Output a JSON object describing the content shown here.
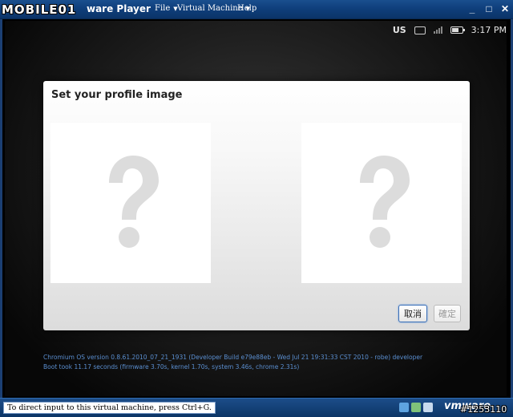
{
  "titlebar": {
    "logo_text": "MOBILE01",
    "app_title": "ware Player",
    "menus": [
      "File",
      "Virtual Machine",
      "Help"
    ]
  },
  "statusbar": {
    "keyboard_layout": "US",
    "time": "3:17 PM"
  },
  "dialog": {
    "title": "Set your profile image",
    "cancel_label": "取消",
    "ok_label": "確定"
  },
  "build_info": {
    "line1": "Chromium OS version 0.8.61.2010_07_21_1931 (Developer Build e79e88eb - Wed Jul 21 19:31:33 CST 2010 - robe) developer",
    "line2": "Boot took 11.17 seconds (firmware 3.70s, kernel 1.70s, system 3.46s, chrome 2.31s)"
  },
  "bottombar": {
    "hint": "To direct input to this virtual machine, press Ctrl+G.",
    "brand": "vmware"
  },
  "watermark": "#1253110",
  "colors": {
    "titlebar": "#0f3f7c",
    "build_info_text": "#5b8fd1",
    "placeholder_glyph": "#d9d9d9"
  }
}
